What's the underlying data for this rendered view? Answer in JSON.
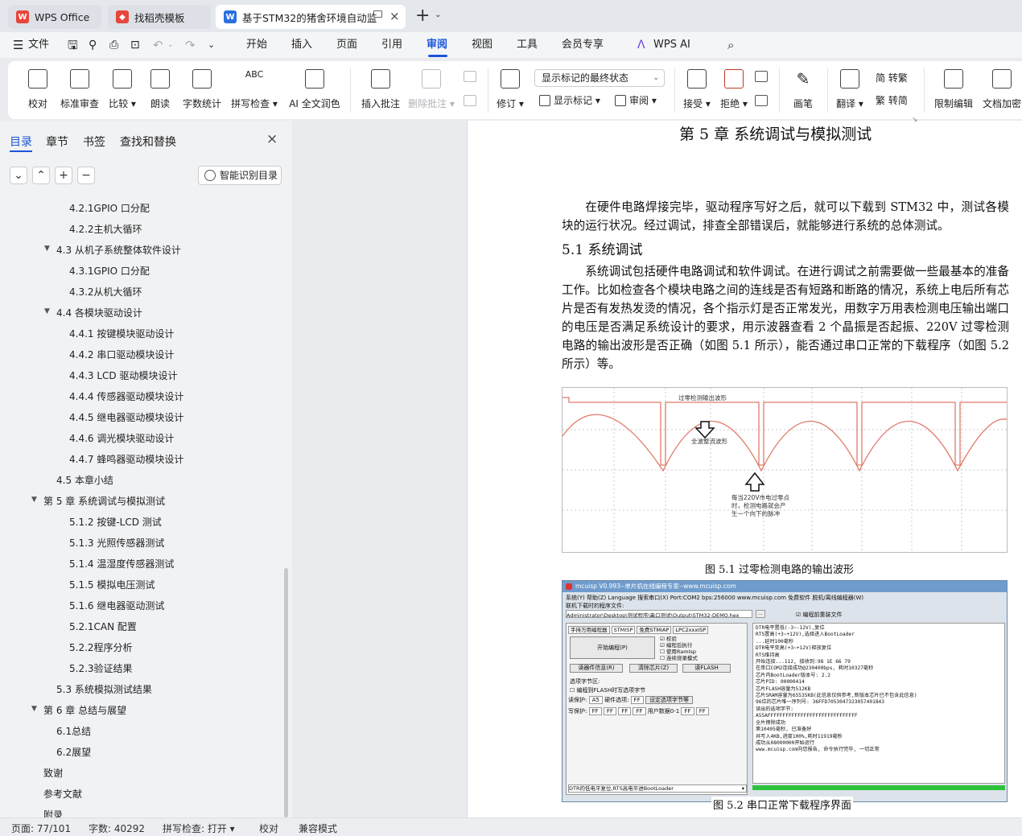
{
  "tabs": [
    {
      "label": "WPS Office"
    },
    {
      "label": "找稻壳模板"
    },
    {
      "label": "基于STM32的猪舍环境自动监"
    }
  ],
  "menu": [
    "文件",
    "开始",
    "插入",
    "页面",
    "引用",
    "审阅",
    "视图",
    "工具",
    "会员专享",
    "WPS AI"
  ],
  "ribbon": {
    "proof": "校对",
    "std_review": "标准审查",
    "compare": "比较",
    "read": "朗读",
    "wordcount": "字数统计",
    "spell": "拼写检查",
    "ai_polish": "AI 全文润色",
    "insert_comment": "插入批注",
    "delete_comment": "删除批注",
    "revise": "修订",
    "show_markup_select": "显示标记的最终状态",
    "show_markup": "显示标记",
    "review_pane": "审阅",
    "accept": "接受",
    "reject": "拒绝",
    "ink": "画笔",
    "translate": "翻译",
    "to_trad": "简 转繁",
    "to_simp": "繁 转简",
    "restrict": "限制编辑",
    "encrypt": "文档加密"
  },
  "sidebar": {
    "tabs": [
      "目录",
      "章节",
      "书签",
      "查找和替换"
    ],
    "smart_toc": "智能识别目录",
    "toc": [
      {
        "text": "4.2.1GPIO 口分配",
        "level": 3
      },
      {
        "text": "4.2.2主机大循环",
        "level": 3
      },
      {
        "text": "4.3  从机子系统整体软件设计",
        "level": 2,
        "caret": true
      },
      {
        "text": "4.3.1GPIO 口分配",
        "level": 3
      },
      {
        "text": "4.3.2从机大循环",
        "level": 3
      },
      {
        "text": "4.4  各模块驱动设计",
        "level": 2,
        "caret": true
      },
      {
        "text": "4.4.1 按键模块驱动设计",
        "level": 3
      },
      {
        "text": "4.4.2 串口驱动模块设计",
        "level": 3
      },
      {
        "text": "4.4.3 LCD 驱动模块设计",
        "level": 3
      },
      {
        "text": "4.4.4 传感器驱动模块设计",
        "level": 3
      },
      {
        "text": "4.4.5 继电器驱动模块设计",
        "level": 3
      },
      {
        "text": "4.4.6 调光模块驱动设计",
        "level": 3
      },
      {
        "text": "4.4.7 蜂鸣器驱动模块设计",
        "level": 3
      },
      {
        "text": "4.5  本章小结",
        "level": 2
      },
      {
        "text": "第 5 章  系统调试与模拟测试",
        "level": 1,
        "caret": true
      },
      {
        "text": "5.1.2 按键-LCD 测试",
        "level": 3
      },
      {
        "text": "5.1.3 光照传感器测试",
        "level": 3
      },
      {
        "text": "5.1.4 温湿度传感器测试",
        "level": 3
      },
      {
        "text": "5.1.5 模拟电压测试",
        "level": 3
      },
      {
        "text": "5.1.6 继电器驱动测试",
        "level": 3
      },
      {
        "text": "5.2.1CAN 配置",
        "level": 3
      },
      {
        "text": "5.2.2程序分析",
        "level": 3
      },
      {
        "text": "5.2.3验证结果",
        "level": 3
      },
      {
        "text": "5.3  系统模拟测试结果",
        "level": 2
      },
      {
        "text": "第 6 章  总结与展望",
        "level": 1,
        "caret": true
      },
      {
        "text": "6.1总结",
        "level": 2
      },
      {
        "text": "6.2展望",
        "level": 2
      },
      {
        "text": "致谢",
        "level": 1
      },
      {
        "text": "参考文献",
        "level": 1
      },
      {
        "text": "附录",
        "level": 1
      }
    ]
  },
  "doc": {
    "chapter_title": "第 5 章  系统调试与模拟测试",
    "para1": "在硬件电路焊接完毕，驱动程序写好之后，就可以下载到 STM32 中，测试各模块的运行状况。经过调试，排查全部错误后，就能够进行系统的总体测试。",
    "section": "5.1  系统调试",
    "para2": "系统调试包括硬件电路调试和软件调试。在进行调试之前需要做一些最基本的准备工作。比如检查各个模块电路之间的连线是否有短路和断路的情况，系统上电后所有芯片是否有发热发烫的情况，各个指示灯是否正常发光，用数字万用表检测电压输出端口的电压是否满足系统设计的要求，用示波器查看 2 个晶振是否起振、220V 过零检测电路的输出波形是否正确（如图 5.1 所示），能否通过串口正常的下载程序（如图 5.2 所示）等。",
    "fig1": {
      "label_top": "过零检测输出波形",
      "label_mid": "全波整流波形",
      "note": [
        "每当220V市电过零点",
        "时，检测电路就会产",
        "生一个向下的脉冲"
      ],
      "caption": "图 5.1 过零检测电路的输出波形"
    },
    "fig2": {
      "title": "mcuisp V0.993--单片机在线编程专家--www.mcuisp.com",
      "menu": "系统(Y)   帮助(Z)   Language   搜索串口(X)   Port:COM2   bps:256000   www.mcuisp.com 免费软件 脱机/离线编程器(W)",
      "file_label": "联机下载时的程序文件:",
      "file_path": "Administrator\\Desktop\\测试程序\\串口测试\\Output\\STM32-DEMO.hex",
      "reload": "编程前重装文件",
      "tabs": [
        "手持万用编程器",
        "STMISP",
        "免费STMIAP",
        "LPC2xxxISP"
      ],
      "start": "开始编程(P)",
      "checks": [
        "校验",
        "编程后执行",
        "使用RamIsp",
        "连续烧录模式"
      ],
      "btn_read": "读器件信息(R)",
      "btn_clear": "清除芯片(Z)",
      "btn_flash": "读FLASH",
      "opt_label": "选项字节区:",
      "opt_check": "编程到FLASH时写选项字节",
      "rp": "读保护:",
      "rp_val": "A5",
      "hw": "硬件选项:",
      "hw_val": "FF",
      "set_opt": "设定选项字节等",
      "wp": "写保护:",
      "ff": "FF",
      "user": "用户数据0-1",
      "dtr": "DTR的低电平复位,RTS高电平进BootLoader",
      "log": [
        "DTR电平置低(-3~-12V),复位",
        "RTS置高(+3~+12V),选择进入BootLoader",
        "...延时100毫秒",
        "DTR电平变高(+3~+12V)释放复位",
        "RTS维持高",
        "开始连接...112, 接收到:98 1E 66 79",
        "在串口COM2连接成功@230400bps, 耗时10327毫秒",
        "芯片内BootLoader版本号: 2.2",
        "芯片PID: 00000414",
        "芯片FLASH容量为512KB",
        "芯片SRAM容量为65535KB(此信息仅供参考,新版本芯片已不包含此信息)",
        "96位的芯片唯一序列号: 36FFD7053047323057401843",
        "读出的选项字节:",
        "A55AFFFFFFFFFFFFFFFFFFFFFFFFFFFFFF",
        "全片擦除成功",
        "第10405毫秒, 已准备好",
        "共写入4KB,进度100%,耗时11919毫秒",
        "成功从08000000开始运行",
        "www.mcuisp.com向您报告, 命令执行完毕, 一切正常"
      ],
      "caption": "图 5.2 串口正常下载程序界面"
    }
  },
  "status": {
    "page": "页面: 77/101",
    "words": "字数: 40292",
    "spell": "拼写检查: 打开",
    "proof": "校对",
    "compat": "兼容模式"
  }
}
